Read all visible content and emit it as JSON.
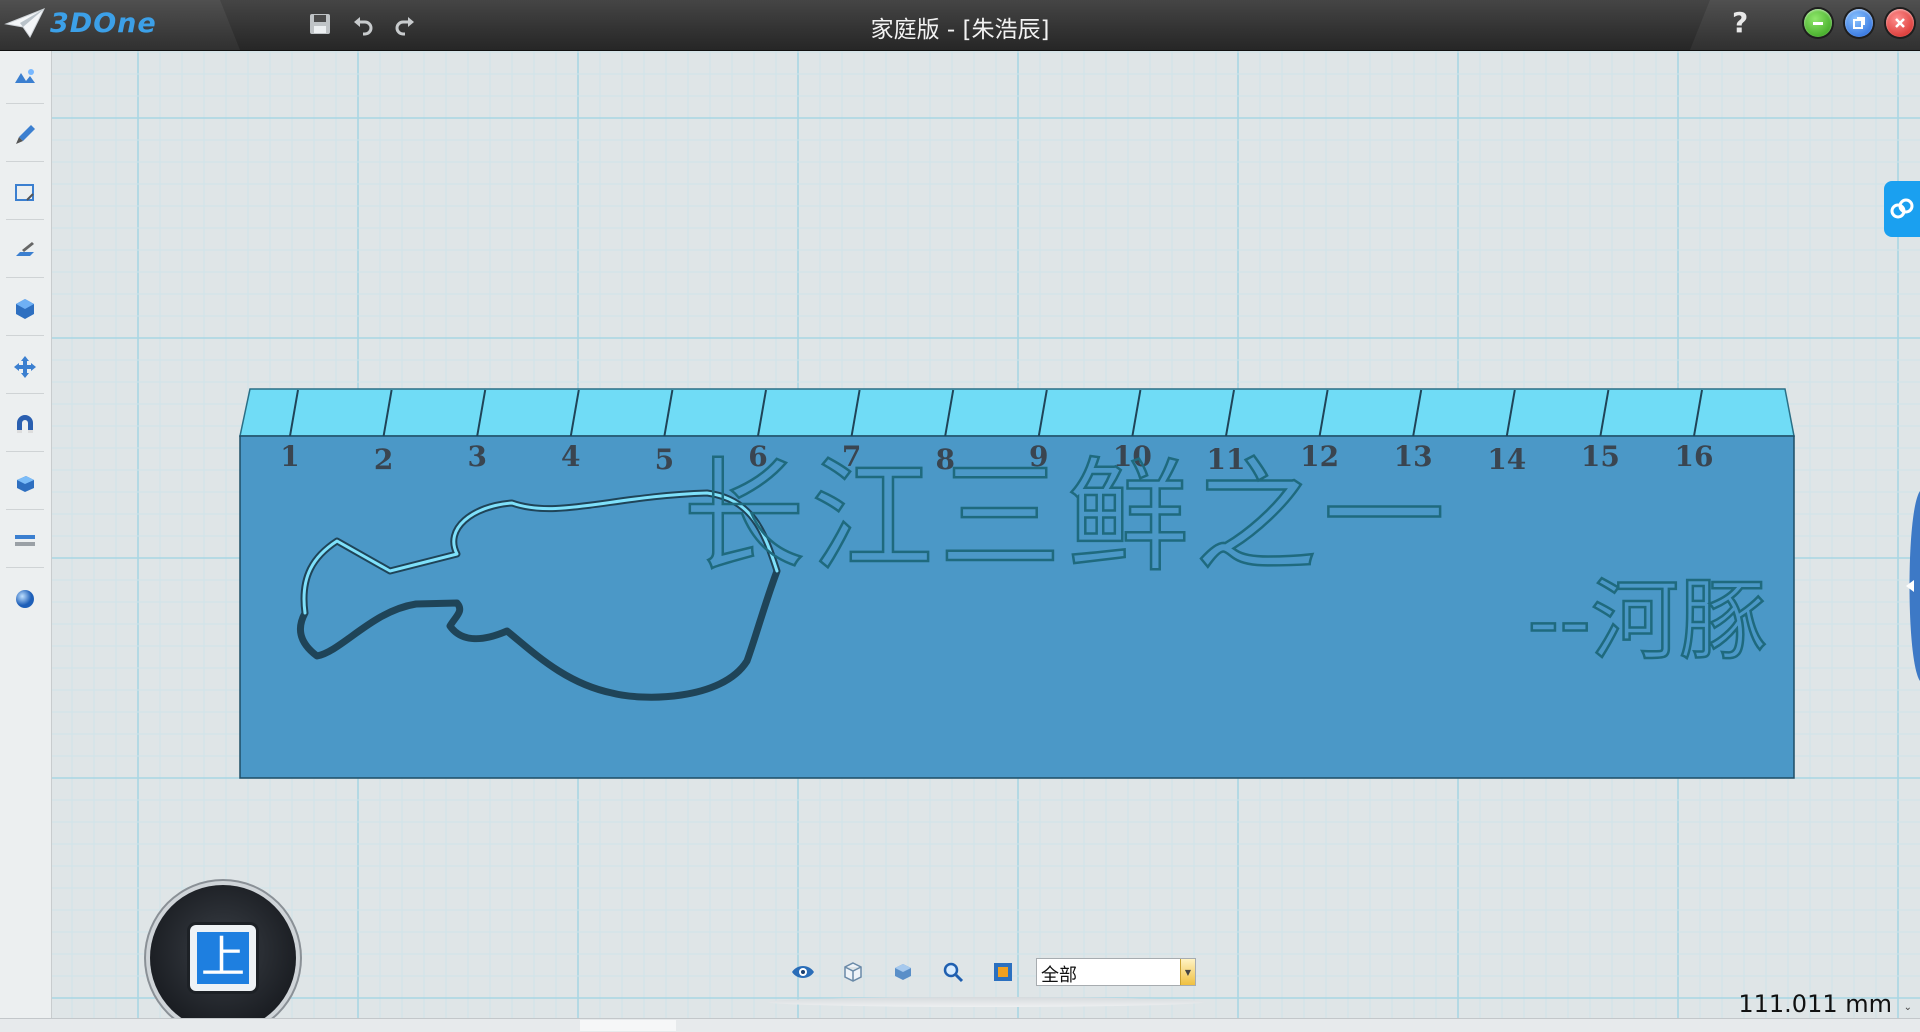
{
  "app": {
    "logo_text": "3DOne",
    "window_title": "家庭版 - [朱浩辰]",
    "help_label": "?"
  },
  "toolbar_top": {
    "items": [
      {
        "name": "save-icon"
      },
      {
        "name": "undo-icon"
      },
      {
        "name": "redo-icon"
      }
    ]
  },
  "left_toolbar": {
    "items": [
      {
        "name": "basic-shapes-icon"
      },
      {
        "name": "sketch-brush-icon"
      },
      {
        "name": "sketch-edit-icon"
      },
      {
        "name": "feature-edit-icon"
      },
      {
        "name": "special-feature-icon"
      },
      {
        "name": "move-icon"
      },
      {
        "name": "magnet-adsorb-icon"
      },
      {
        "name": "combine-icon"
      },
      {
        "name": "distance-measure-icon"
      },
      {
        "name": "material-render-icon"
      }
    ]
  },
  "model": {
    "ruler_numbers": [
      "1",
      "2",
      "3",
      "4",
      "5",
      "6",
      "7",
      "8",
      "9",
      "10",
      "11",
      "12",
      "13",
      "14",
      "15",
      "16"
    ],
    "main_text": "长江三鲜之一",
    "sub_text": "--河豚",
    "colors": {
      "face": "#4b98c7",
      "top": "#70dcf6",
      "text_stroke": "#1f6a7e"
    }
  },
  "viewcube": {
    "label": "上",
    "accent": "#1e7fe0"
  },
  "bottom_toolbar": {
    "buttons": [
      {
        "name": "visibility-eye-icon"
      },
      {
        "name": "wireframe-cube-icon"
      },
      {
        "name": "shaded-cube-icon"
      },
      {
        "name": "zoom-search-icon"
      },
      {
        "name": "view-fit-icon"
      }
    ],
    "filter_value": "全部"
  },
  "status": {
    "scale_readout": "111.011 mm"
  }
}
